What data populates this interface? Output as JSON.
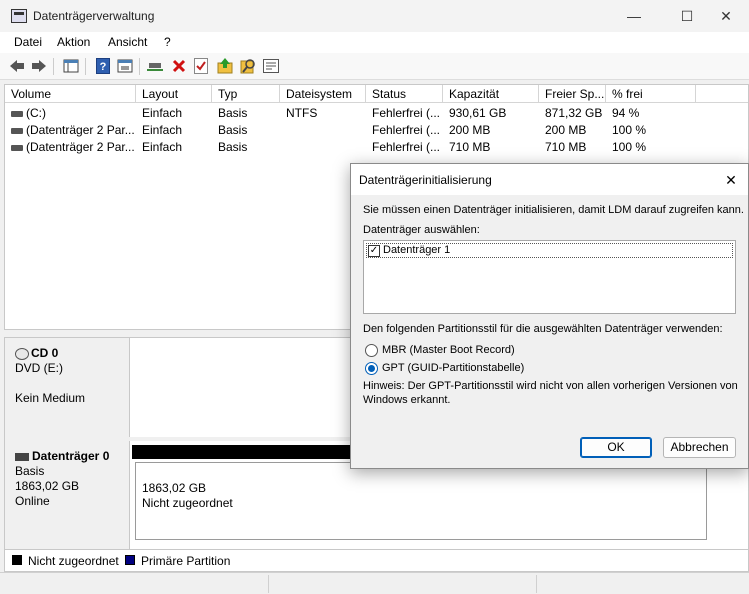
{
  "window": {
    "title": "Datenträgerverwaltung",
    "minimize": "—",
    "maximize": "☐",
    "close": "✕"
  },
  "menu": [
    "Datei",
    "Aktion",
    "Ansicht",
    "?"
  ],
  "toolbar": [
    "back-icon",
    "forward-icon",
    "console-tree-icon",
    "help-icon",
    "properties-icon",
    "connect-icon",
    "delete-icon",
    "check-icon",
    "export-icon",
    "search-icon",
    "settings-icon"
  ],
  "volume_list": {
    "headers": [
      "Volume",
      "Layout",
      "Typ",
      "Dateisystem",
      "Status",
      "Kapazität",
      "Freier Sp...",
      "% frei"
    ],
    "rows": [
      [
        "(C:)",
        "Einfach",
        "Basis",
        "NTFS",
        "Fehlerfrei (...",
        "930,61 GB",
        "871,32 GB",
        "94 %"
      ],
      [
        "(Datenträger 2 Par...",
        "Einfach",
        "Basis",
        "",
        "Fehlerfrei (...",
        "200 MB",
        "200 MB",
        "100 %"
      ],
      [
        "(Datenträger 2 Par...",
        "Einfach",
        "Basis",
        "",
        "Fehlerfrei (...",
        "710 MB",
        "710 MB",
        "100 %"
      ]
    ]
  },
  "disks": {
    "cd0": {
      "name": "CD 0",
      "line1": "DVD (E:)",
      "line2": "Kein Medium"
    },
    "disk0": {
      "name": "Datenträger 0",
      "type": "Basis",
      "size": "1863,02 GB",
      "state": "Online",
      "partition_size": "1863,02 GB",
      "partition_state": "Nicht zugeordnet"
    }
  },
  "legend": {
    "unallocated": "Nicht zugeordnet",
    "primary": "Primäre Partition",
    "unallocated_color": "#000000",
    "primary_color": "#000080"
  },
  "dialog": {
    "title": "Datenträgerinitialisierung",
    "intro": "Sie müssen einen Datenträger initialisieren, damit LDM darauf zugreifen kann.",
    "select_label": "Datenträger auswählen:",
    "disk_item": "Datenträger 1",
    "disk_checked": true,
    "style_label": "Den folgenden Partitionsstil für die ausgewählten Datenträger verwenden:",
    "option_mbr": "MBR (Master Boot Record)",
    "option_gpt": "GPT (GUID-Partitionstabelle)",
    "selected": "GPT",
    "hint1": "Hinweis: Der GPT-Partitionsstil wird nicht von allen vorherigen Versionen von",
    "hint2": "Windows erkannt.",
    "ok": "OK",
    "cancel": "Abbrechen",
    "close": "✕"
  }
}
